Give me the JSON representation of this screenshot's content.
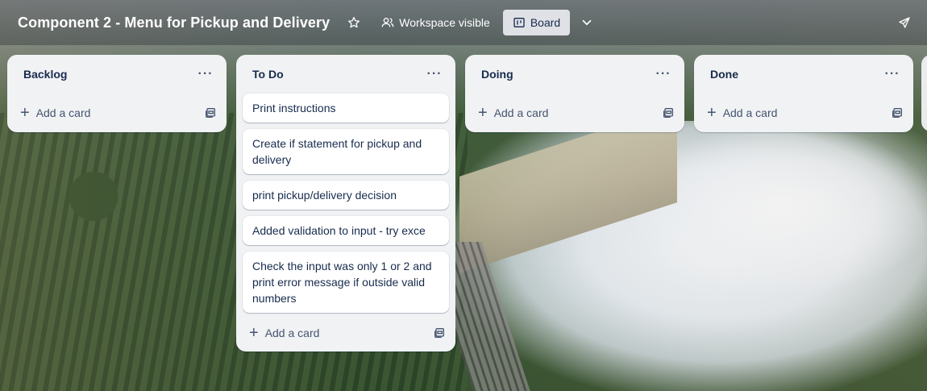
{
  "board": {
    "title": "Component 2 - Menu for Pickup and Delivery",
    "visibility_label": "Workspace visible",
    "view_label": "Board"
  },
  "lists": [
    {
      "title": "Backlog",
      "cards": [],
      "add_card_label": "Add a card"
    },
    {
      "title": "To Do",
      "cards": [
        "Print instructions",
        "Create if statement for pickup and delivery",
        "print pickup/delivery decision",
        "Added validation to input - try exce",
        "Check the input was only 1 or 2 and print error message if outside valid numbers"
      ],
      "add_card_label": "Add a card"
    },
    {
      "title": "Doing",
      "cards": [],
      "add_card_label": "Add a card"
    },
    {
      "title": "Done",
      "cards": [],
      "add_card_label": "Add a card"
    }
  ],
  "icons": {
    "star": "star-icon",
    "workspace": "people-icon",
    "board": "board-icon",
    "chevron": "chevron-down-icon",
    "share": "send-icon",
    "list_menu": "more-icon",
    "add": "plus-icon",
    "template": "card-template-icon"
  }
}
